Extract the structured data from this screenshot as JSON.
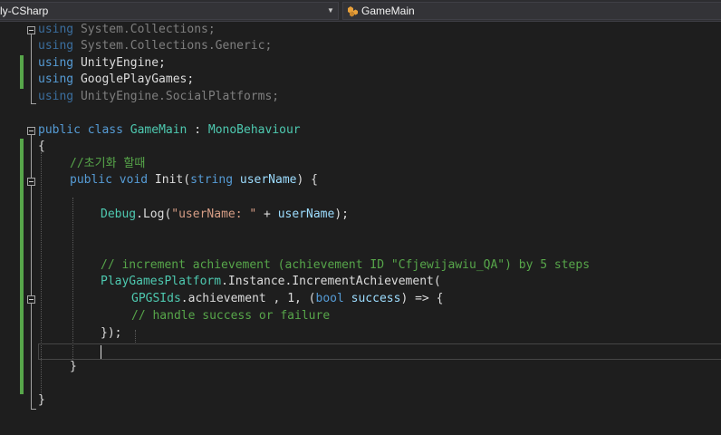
{
  "nav": {
    "project": "ly-CSharp",
    "class_name": "GameMain"
  },
  "code": {
    "l1": {
      "kw": "using",
      "ns": " System.Collections;"
    },
    "l2": {
      "kw": "using",
      "ns": " System.Collections.Generic;"
    },
    "l3": {
      "kw": "using",
      "ns": " UnityEngine;"
    },
    "l4": {
      "kw": "using",
      "ns": " GooglePlayGames;"
    },
    "l5": {
      "kw": "using",
      "ns": " UnityEngine.SocialPlatforms;"
    },
    "l7": {
      "kw1": "public",
      "kw2": " class",
      "name": " GameMain",
      "colon": " : ",
      "base": "MonoBehaviour"
    },
    "l8": {
      "brace": "{"
    },
    "l9": {
      "comment": "//초기화 할때"
    },
    "l10": {
      "kw1": "public",
      "kw2": " void",
      "name": " Init(",
      "type": "string",
      "param": " userName",
      "end": ") {"
    },
    "l12": {
      "obj": "Debug",
      "call": ".Log(",
      "str": "\"userName: \"",
      "op": " + ",
      "param": "userName",
      "end": ");"
    },
    "l15": {
      "comment": "// increment achievement (achievement ID \"Cfjewijawiu_QA\") by 5 steps"
    },
    "l16": {
      "cls": "PlayGamesPlatform",
      "mid": ".Instance.IncrementAchievement("
    },
    "l17": {
      "cls": "GPGSIds",
      "mid": ".achievement , 1, (",
      "type": "bool",
      "param": " success",
      "end": ") => {"
    },
    "l18": {
      "comment": "// handle success or failure"
    },
    "l19": {
      "end": "});"
    },
    "l21": {
      "brace": "}"
    },
    "l23": {
      "brace": "}"
    }
  },
  "colors": {
    "background": "#1e1e1e",
    "keyword": "#569cd6",
    "type": "#4ec9b0",
    "comment": "#57a64a",
    "string": "#d69d85",
    "parameter": "#9cdcfe",
    "text": "#dcdcdc",
    "change_marker": "#57a64a"
  },
  "icons": {
    "class_icon": "class-icon",
    "dropdown": "chevron-down-icon"
  }
}
